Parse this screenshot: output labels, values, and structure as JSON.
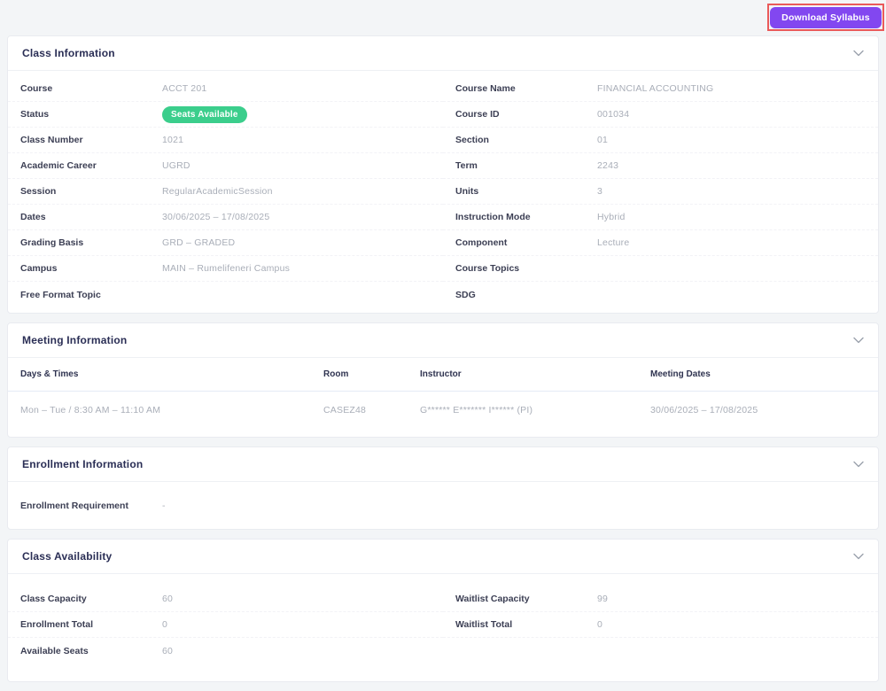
{
  "page": {
    "download_button": "Download Syllabus"
  },
  "colors": {
    "accent_purple": "#8247f0",
    "badge_green": "#3bce8c",
    "annotation_red": "#ea5a5a",
    "title_navy": "#2a2e55",
    "value_gray": "#a9aeb8",
    "page_background": "#f3f5f7"
  },
  "icons": {
    "section_collapse": "chevron-down"
  },
  "class_information": {
    "title": "Class Information",
    "left": [
      {
        "label": "Course",
        "value": "ACCT 201"
      },
      {
        "label": "Status",
        "value": "Seats Available"
      },
      {
        "label": "Class Number",
        "value": "1021"
      },
      {
        "label": "Academic Career",
        "value": "UGRD"
      },
      {
        "label": "Session",
        "value": "RegularAcademicSession"
      },
      {
        "label": "Dates",
        "value": "30/06/2025 – 17/08/2025"
      },
      {
        "label": "Grading Basis",
        "value": "GRD – GRADED"
      },
      {
        "label": "Campus",
        "value": "MAIN – Rumelifeneri Campus"
      },
      {
        "label": "Free Format Topic",
        "value": ""
      }
    ],
    "right": [
      {
        "label": "Course Name",
        "value": "FINANCIAL ACCOUNTING"
      },
      {
        "label": "Course ID",
        "value": "001034"
      },
      {
        "label": "Section",
        "value": "01"
      },
      {
        "label": "Term",
        "value": "2243"
      },
      {
        "label": "Units",
        "value": "3"
      },
      {
        "label": "Instruction Mode",
        "value": "Hybrid"
      },
      {
        "label": "Component",
        "value": "Lecture"
      },
      {
        "label": "Course Topics",
        "value": ""
      },
      {
        "label": "SDG",
        "value": ""
      }
    ]
  },
  "meeting_information": {
    "title": "Meeting Information",
    "columns": [
      "Days & Times",
      "Room",
      "Instructor",
      "Meeting Dates"
    ],
    "row": {
      "days_times": "Mon – Tue / 8:30 AM – 11:10 AM",
      "room": "CASEZ48",
      "instructor": "G****** E******* I****** (PI)",
      "meeting_dates": "30/06/2025 – 17/08/2025"
    }
  },
  "enrollment_information": {
    "title": "Enrollment Information",
    "rows": [
      {
        "label": "Enrollment Requirement",
        "value": "-"
      }
    ]
  },
  "class_availability": {
    "title": "Class Availability",
    "left": [
      {
        "label": "Class Capacity",
        "value": "60"
      },
      {
        "label": "Enrollment Total",
        "value": "0"
      },
      {
        "label": "Available Seats",
        "value": "60"
      }
    ],
    "right": [
      {
        "label": "Waitlist Capacity",
        "value": "99"
      },
      {
        "label": "Waitlist Total",
        "value": "0"
      },
      {
        "label": "",
        "value": ""
      }
    ]
  }
}
